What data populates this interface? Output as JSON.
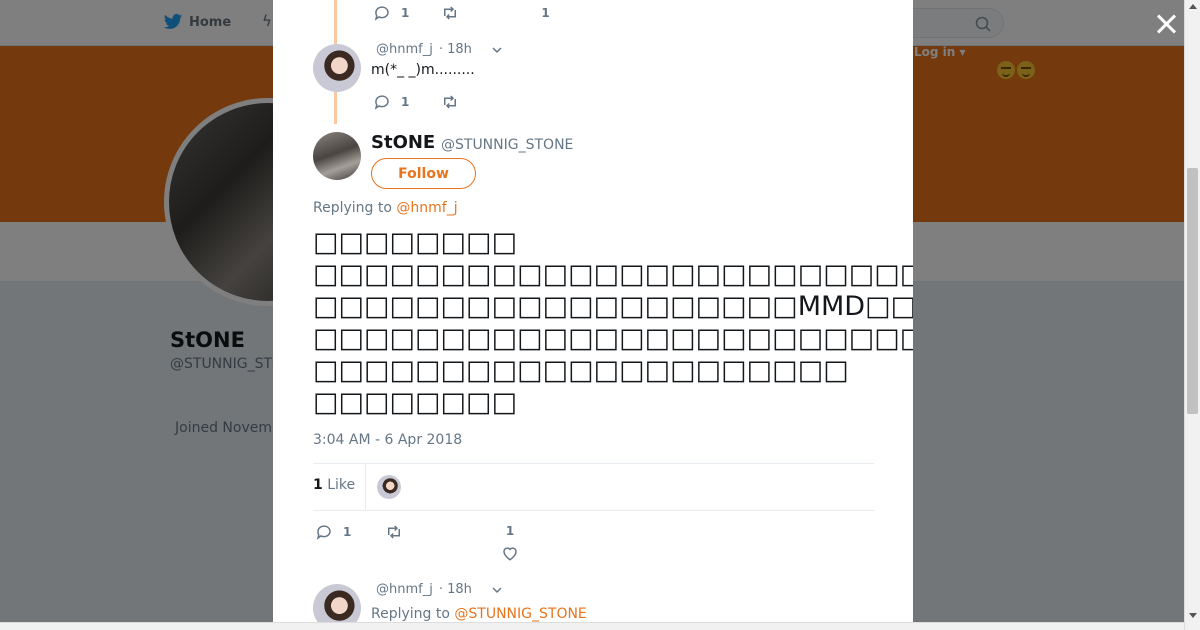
{
  "header": {
    "home_label": "Home",
    "login_label": "Log in ▾"
  },
  "profile": {
    "name": "StONE",
    "handle": "@STUNNIG_STONE",
    "joined": "Joined November"
  },
  "thread_above": [
    {
      "reply_count": "1",
      "like_count": "1"
    },
    {
      "handle": "@hnmf_j",
      "time": "· 18h",
      "text": "m(*_ _)m.........",
      "reply_count": "1"
    }
  ],
  "main_tweet": {
    "name": "StONE",
    "handle": "@STUNNIG_STONE",
    "follow_label": "Follow",
    "replying_prefix": "Replying to ",
    "replying_to": "@hnmf_j",
    "lines": [
      "□□□□□□□□",
      "□□□□□□□□□□□□□□□□□□□□□□□□□□□□□□□□□□□□□□□□□□□",
      "□□□□□□□□□□□□□□□□□□□MMD□□□□□□□□□□□□□□□□□□□□□□□□",
      "□□□□□□□□□□□□□□□□□□□□□□□□□□□□□□□",
      "□□□□□□□□□□□□□□□□□□□□□",
      "□□□□□□□□"
    ],
    "timestamp": "3:04 AM - 6 Apr 2018",
    "likes_count": "1",
    "likes_label": "Like",
    "reply_count": "1",
    "like_count": "1"
  },
  "thread_below": {
    "handle": "@hnmf_j",
    "time": "· 18h",
    "replying_prefix": "Replying to ",
    "replying_to": "@STUNNIG_STONE"
  },
  "colors": {
    "accent": "#e8741d",
    "text": "#14171a",
    "muted": "#657786",
    "thread": "#fbc8a1"
  }
}
